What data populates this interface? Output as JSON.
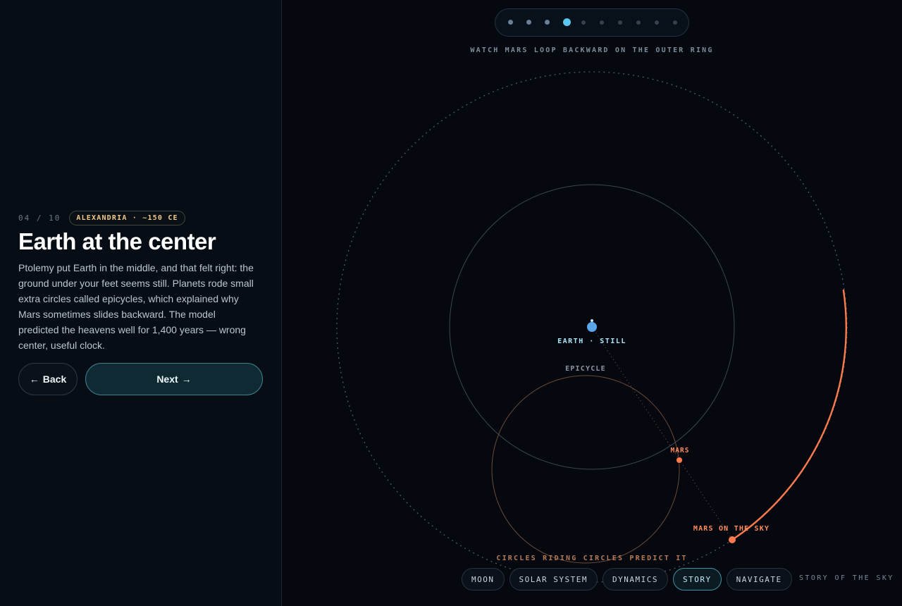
{
  "story": {
    "step": "04 / 10",
    "era": "ALEXANDRIA · ~150 CE",
    "title": "Earth at the center",
    "body": "Ptolemy put Earth in the middle, and that felt right: the ground under your feet seems still. Planets rode small extra circles called epicycles, which explained why Mars sometimes slides backward. The model predicted the heavens well for 1,400 years — wrong center, useful clock.",
    "back_label": "Back",
    "next_label": "Next",
    "back_arrow": "←",
    "next_arrow": "→"
  },
  "progress": {
    "total_steps": 10,
    "current_step": 4
  },
  "diagram": {
    "caption_top": "WATCH MARS LOOP BACKWARD ON THE OUTER RING",
    "earth_label": "EARTH · STILL",
    "epicycle_label": "EPICYCLE",
    "mars_label": "MARS",
    "mars_sky_label": "MARS ON THE SKY",
    "caption_bottom": "CIRCLES RIDING CIRCLES PREDICT IT",
    "colors": {
      "earth": "#5ba6ea",
      "mars": "#ff7a4c",
      "accent": "#58c8f0"
    }
  },
  "nav": {
    "items": [
      {
        "label": "MOON"
      },
      {
        "label": "SOLAR SYSTEM"
      },
      {
        "label": "DYNAMICS"
      },
      {
        "label": "STORY",
        "active": true
      },
      {
        "label": "NAVIGATE"
      }
    ]
  },
  "brand": "STORY OF THE SKY"
}
